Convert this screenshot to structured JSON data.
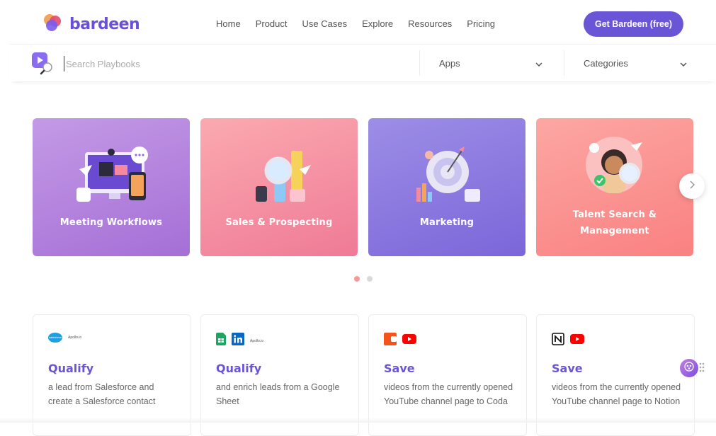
{
  "header": {
    "brand": "bardeen",
    "nav": [
      "Home",
      "Product",
      "Use Cases",
      "Explore",
      "Resources",
      "Pricing"
    ],
    "cta_label": "Get Bardeen (free)"
  },
  "search": {
    "placeholder": "Search Playbooks",
    "apps_label": "Apps",
    "categories_label": "Categories"
  },
  "categories": [
    {
      "label": "Meeting Workflows"
    },
    {
      "label": "Sales & Prospecting"
    },
    {
      "label": "Marketing"
    },
    {
      "label_line1": "Talent Search &",
      "label_line2": "Management"
    }
  ],
  "carousel": {
    "active_index": 0,
    "page_count": 2
  },
  "playbooks": [
    {
      "title": "Qualify",
      "desc": "a lead from Salesforce and create a Salesforce contact",
      "app_text": "salesforce",
      "app_text2": "Apollo.io"
    },
    {
      "title": "Qualify",
      "desc": "and enrich leads from a Google Sheet",
      "app_text": "Apollo.io"
    },
    {
      "title": "Save",
      "desc": "videos from the currently opened YouTube channel page to Coda"
    },
    {
      "title": "Save",
      "desc": "videos from the currently opened YouTube channel page to Notion"
    }
  ],
  "colors": {
    "brand": "#6a55d6",
    "card1": "#b07fd9",
    "card2": "#f48aa0",
    "card3": "#8a78e0",
    "card4": "#fb8f8f",
    "dot_active": "#f49a9a",
    "dot_inactive": "#d9d9d9"
  }
}
